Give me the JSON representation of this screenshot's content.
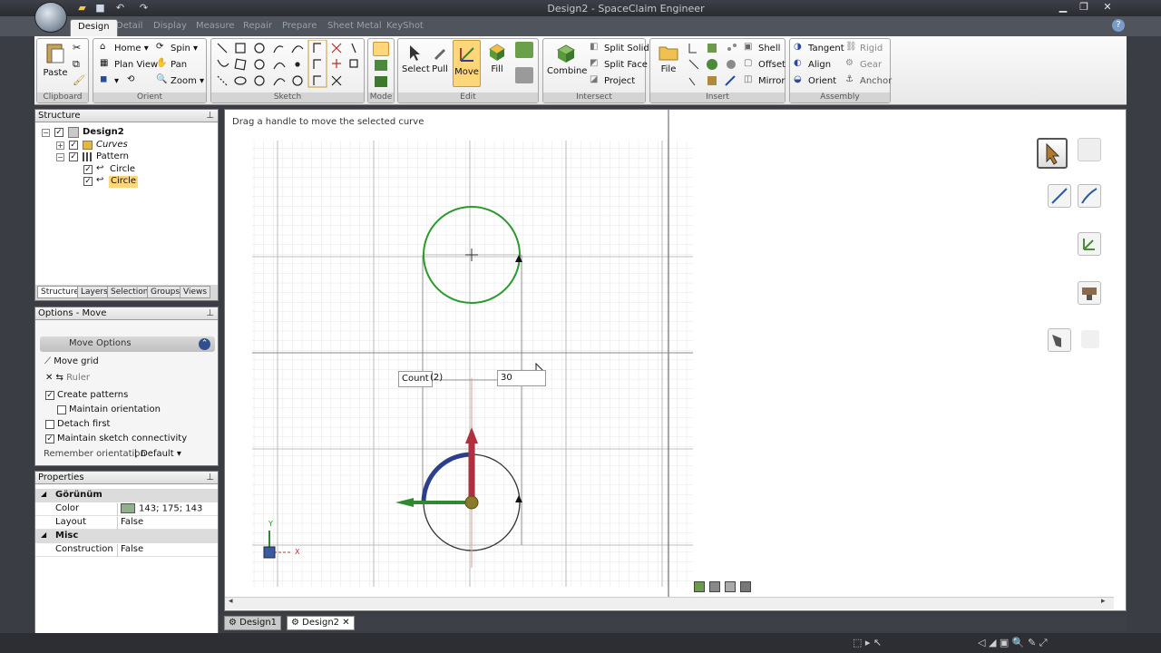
{
  "app": {
    "title": "Design2 - SpaceClaim Engineer"
  },
  "ribbon": {
    "tabs": [
      "Design",
      "Detail",
      "Display",
      "Measure",
      "Repair",
      "Prepare",
      "Sheet Metal",
      "KeyShot"
    ],
    "active_tab": "Design",
    "groups": {
      "clipboard": {
        "label": "Clipboard",
        "paste": "Paste"
      },
      "orient": {
        "label": "Orient",
        "home": "Home",
        "spin": "Spin",
        "plan_view": "Plan View",
        "pan": "Pan",
        "zoom": "Zoom"
      },
      "sketch": {
        "label": "Sketch"
      },
      "mode": {
        "label": "Mode"
      },
      "edit": {
        "label": "Edit",
        "select": "Select",
        "pull": "Pull",
        "move": "Move",
        "fill": "Fill"
      },
      "intersect": {
        "label": "Intersect",
        "combine": "Combine",
        "split_solid": "Split Solid",
        "split_face": "Split Face",
        "project": "Project"
      },
      "insert": {
        "label": "Insert",
        "file": "File",
        "shell": "Shell",
        "offset": "Offset",
        "mirror": "Mirror"
      },
      "assembly": {
        "label": "Assembly",
        "tangent": "Tangent",
        "rigid": "Rigid",
        "align": "Align",
        "gear": "Gear",
        "orient": "Orient",
        "anchor": "Anchor"
      }
    }
  },
  "structure": {
    "title": "Structure",
    "tree": {
      "root": "Design2",
      "curves": "Curves",
      "pattern": "Pattern",
      "circle1": "Circle",
      "circle2": "Circle"
    },
    "tabs": [
      "Structure",
      "Layers",
      "Selection",
      "Groups",
      "Views"
    ]
  },
  "options": {
    "title": "Options - Move",
    "section": "Move Options",
    "move_grid": "Move grid",
    "ruler": "Ruler",
    "create_patterns": "Create patterns",
    "maintain_orientation": "Maintain orientation",
    "detach_first": "Detach first",
    "maintain_sketch": "Maintain sketch connectivity",
    "remember_orientation": "Remember orientation",
    "default_value": "Default",
    "create_patterns_checked": true,
    "maintain_orientation_checked": false,
    "detach_first_checked": false,
    "maintain_sketch_checked": true
  },
  "properties": {
    "title": "Properties",
    "cat1": "Görünüm",
    "color_key": "Color",
    "color_value": "143; 175; 143",
    "color_swatch": "#8faf8f",
    "layout_key": "Layout",
    "layout_value": "False",
    "cat2": "Misc",
    "construction_key": "Construction",
    "construction_value": "False"
  },
  "viewport": {
    "hint": "Drag a handle to move the selected curve",
    "count_label": "Count",
    "count_value": "(2)",
    "dimension_value": "30",
    "axis_x": "X",
    "axis_y": "Y"
  },
  "doc_tabs": [
    "Design1",
    "Design2"
  ],
  "active_doc_tab": "Design2",
  "colors": {
    "circle_green": "#2a9a2a",
    "arrow_red": "#b03040",
    "arrow_green": "#2f8a2f",
    "arrow_blue": "#2c3f8c"
  }
}
